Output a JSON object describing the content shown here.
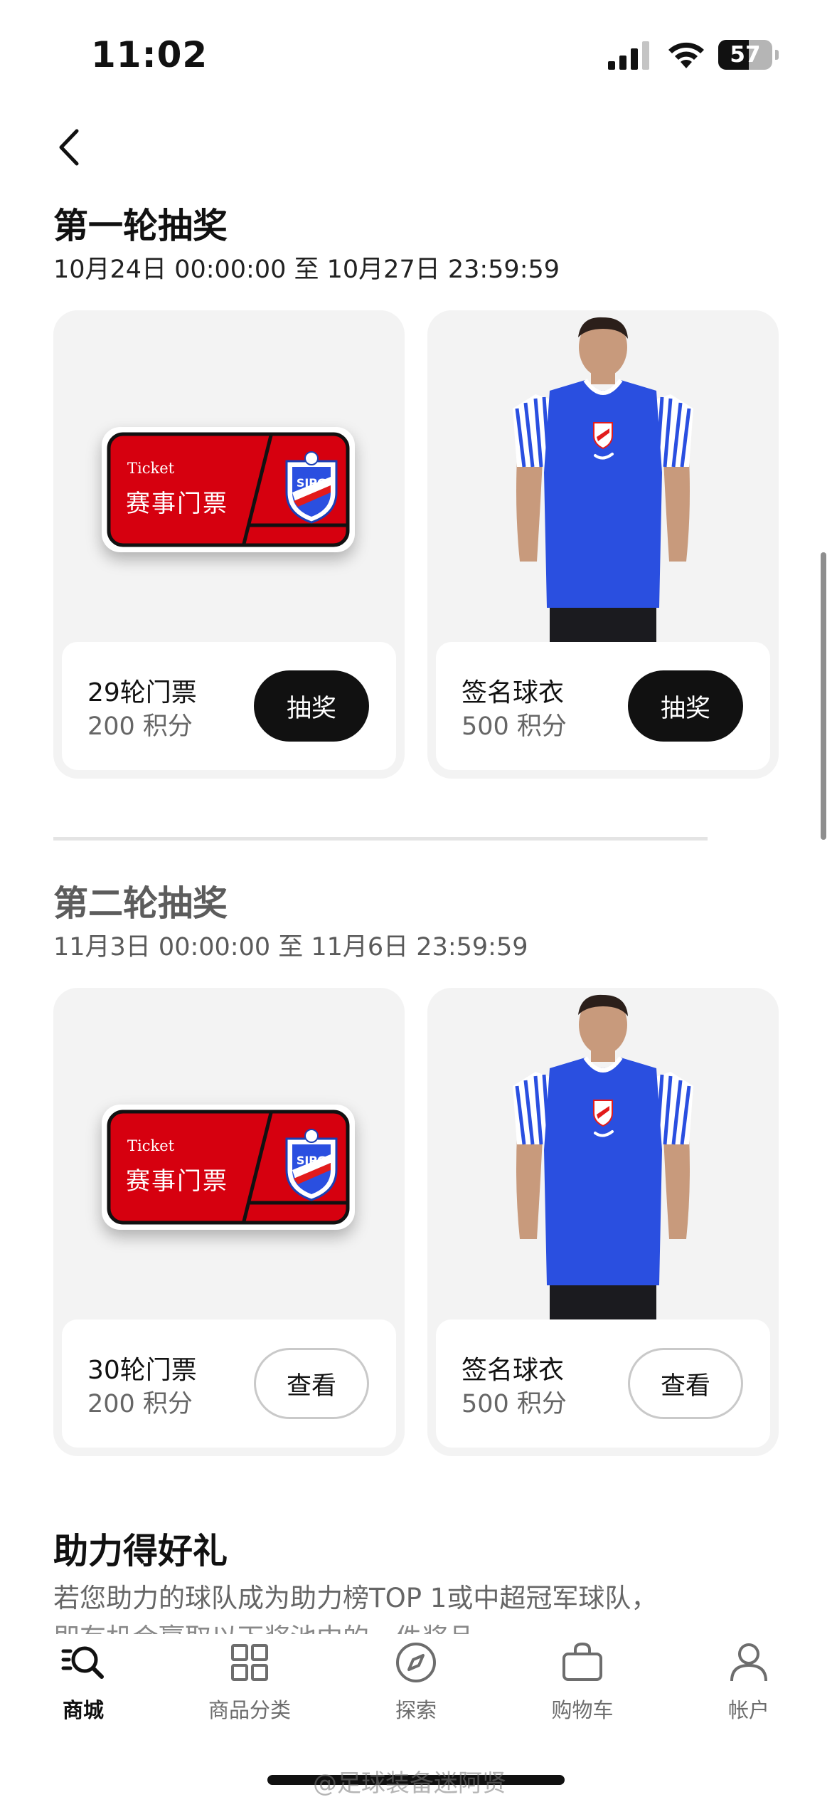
{
  "status_bar": {
    "time": "11:02",
    "battery": "57",
    "battery_level": 0.57
  },
  "rounds": [
    {
      "title": "第一轮抽奖",
      "date_range": "10月24日 00:00:00 至 10月27日 23:59:59",
      "prizes": [
        {
          "name": "29轮门票",
          "cost": "200 积分",
          "button": "抽奖",
          "image": "ticket",
          "ticket_en": "Ticket",
          "ticket_cn": "赛事门票"
        },
        {
          "name": "签名球衣",
          "cost": "500 积分",
          "button": "抽奖",
          "image": "jersey-model"
        }
      ]
    },
    {
      "title": "第二轮抽奖",
      "date_range": "11月3日 00:00:00 至 11月6日 23:59:59",
      "prizes": [
        {
          "name": "30轮门票",
          "cost": "200 积分",
          "button": "查看",
          "image": "ticket",
          "ticket_en": "Ticket",
          "ticket_cn": "赛事门票"
        },
        {
          "name": "签名球衣",
          "cost": "500 积分",
          "button": "查看",
          "image": "jersey-model"
        }
      ]
    }
  ],
  "section": {
    "title": "助力得好礼",
    "description": "若您助力的球队成为助力榜TOP 1或中超冠军球队，",
    "description_cont": "即有机会赢取以下奖池中的一件奖品"
  },
  "tabs": [
    {
      "label": "商城",
      "icon": "search-list-icon",
      "active": true
    },
    {
      "label": "商品分类",
      "icon": "grid-icon",
      "active": false
    },
    {
      "label": "探索",
      "icon": "compass-icon",
      "active": false
    },
    {
      "label": "购物车",
      "icon": "bag-icon",
      "active": false
    },
    {
      "label": "帐户",
      "icon": "person-icon",
      "active": false
    }
  ],
  "watermark": "@足球装备迷阿贤",
  "colors": {
    "ticket_red": "#d6000f",
    "jersey_blue": "#2a4fe0",
    "primary_button": "#111111"
  }
}
